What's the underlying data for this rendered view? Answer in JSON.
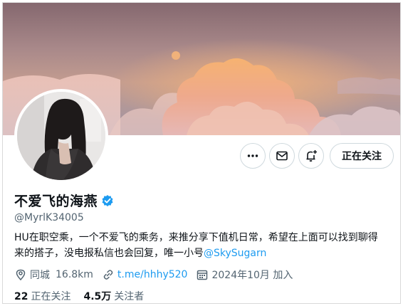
{
  "profile": {
    "display_name": "不爱飞的海燕",
    "handle": "@MyrlK34005",
    "bio_text": "HU在职空乘，一个不爱飞的乘务，来推分享下值机日常，希望在上面可以找到聊得来的搭子，没电报私信也会回复，唯一小号",
    "bio_mention": "@SkySugarn",
    "location_label": "同城",
    "location_distance": "16.8km",
    "website": "t.me/hhhy520",
    "joined": "2024年10月 加入"
  },
  "actions": {
    "more_icon": "more-horizontal-icon",
    "message_icon": "envelope-icon",
    "notify_icon": "bell-plus-icon",
    "follow_label": "正在关注"
  },
  "stats": {
    "following_count": "22",
    "following_label": "正在关注",
    "followers_count": "4.5万",
    "followers_label": "关注者"
  },
  "colors": {
    "accent": "#1d9bf0",
    "secondary_text": "#536471",
    "border": "#cfd9de"
  }
}
